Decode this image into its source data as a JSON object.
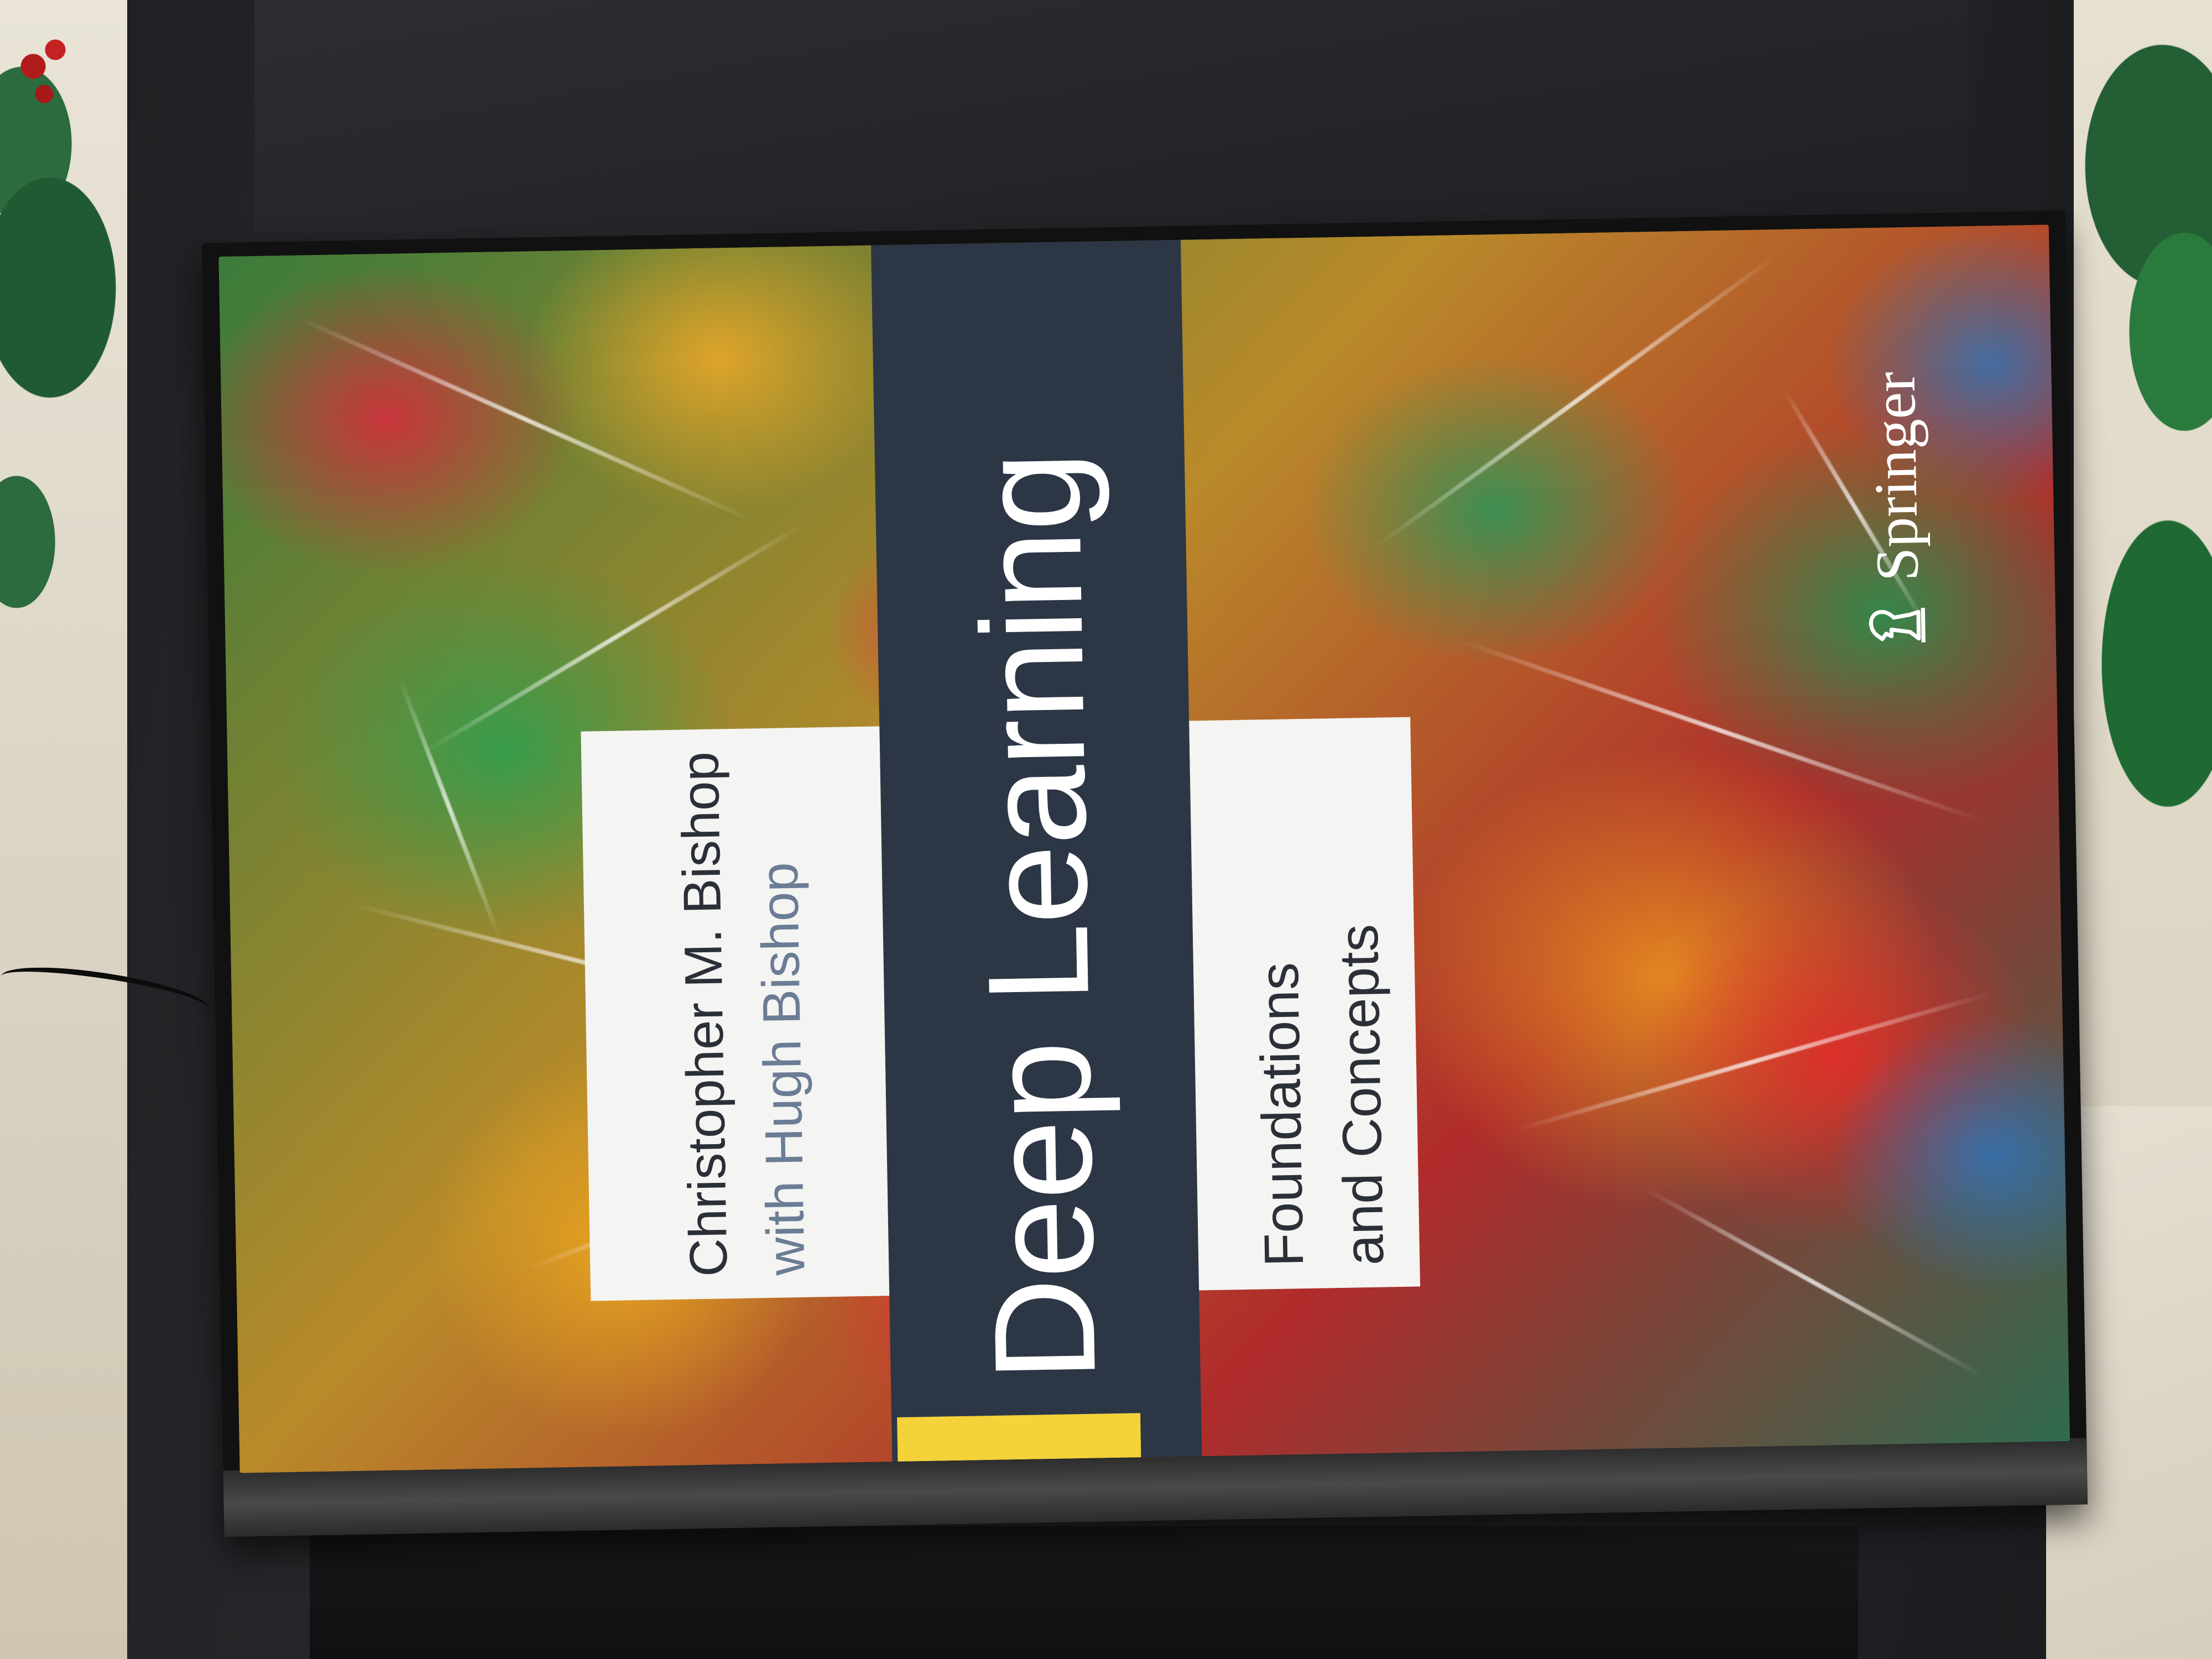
{
  "book": {
    "title": "Deep Learning",
    "author": "Christopher M. Bishop",
    "coauthor": "with Hugh Bishop",
    "subtitle_line1": "Foundations",
    "subtitle_line2": "and Concepts",
    "publisher": "Springer",
    "publisher_logo_icon": "chess-knight-logo-icon"
  },
  "colors": {
    "title_band": "#2c3645",
    "panel_white": "#f4f4f2",
    "coauthor_text": "#6b7c95",
    "yellow_tab": "#f3d23a"
  }
}
